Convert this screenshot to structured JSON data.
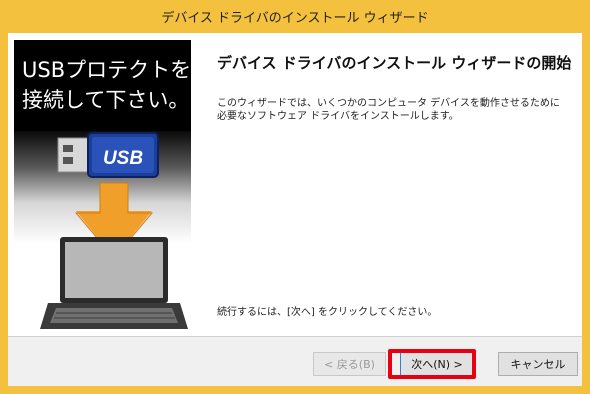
{
  "window": {
    "title": "デバイス ドライバのインストール ウィザード"
  },
  "banner": {
    "line1": "USBプロテクトを",
    "line2": "接続して下さい。",
    "usb_label": "USB"
  },
  "main": {
    "heading": "デバイス ドライバのインストール ウィザードの開始",
    "description_line1": "このウィザードでは、いくつかのコンピュータ デバイスを動作させるために",
    "description_line2": "必要なソフトウェア ドライバをインストールします。",
    "continue_text": "続行するには、[次へ] をクリックしてください。"
  },
  "buttons": {
    "back": "< 戻る(B)",
    "next": "次へ(N) >",
    "cancel": "キャンセル"
  },
  "colors": {
    "title_bar": "#f3c13e",
    "highlight": "#e60012",
    "arrow": "#f0a02a",
    "usb_blue": "#1c3f9c"
  }
}
